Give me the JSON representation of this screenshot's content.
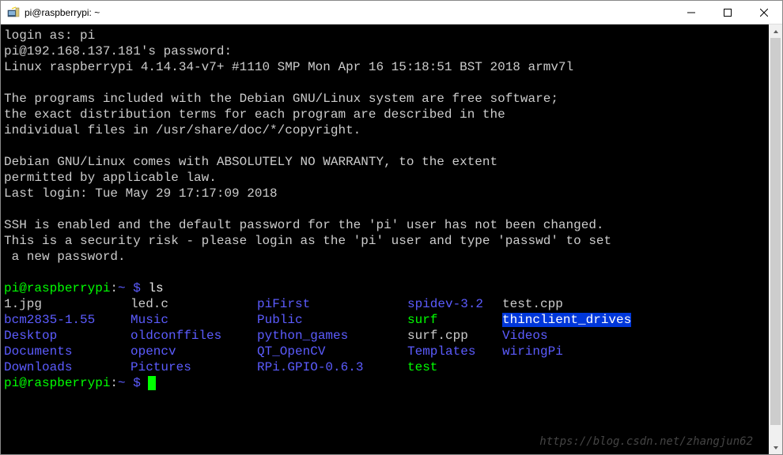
{
  "window": {
    "title": "pi@raspberrypi: ~"
  },
  "terminal": {
    "login_prompt": "login as: ",
    "login_user": "pi",
    "password_prompt": "pi@192.168.137.181's password:",
    "kernel_line": "Linux raspberrypi 4.14.34-v7+ #1110 SMP Mon Apr 16 15:18:51 BST 2018 armv7l",
    "motd1": "The programs included with the Debian GNU/Linux system are free software;",
    "motd2": "the exact distribution terms for each program are described in the",
    "motd3": "individual files in /usr/share/doc/*/copyright.",
    "motd4": "Debian GNU/Linux comes with ABSOLUTELY NO WARRANTY, to the extent",
    "motd5": "permitted by applicable law.",
    "last_login": "Last login: Tue May 29 17:17:09 2018",
    "ssh1": "SSH is enabled and the default password for the 'pi' user has not been changed.",
    "ssh2": "This is a security risk - please login as the 'pi' user and type 'passwd' to set",
    "ssh3": " a new password.",
    "prompt_user": "pi@raspberrypi",
    "prompt_sep": ":",
    "prompt_path": "~ $",
    "cmd1": " ls",
    "ls": {
      "rows": [
        [
          {
            "name": "1.jpg",
            "type": "file"
          },
          {
            "name": "led.c",
            "type": "file"
          },
          {
            "name": "piFirst",
            "type": "dir"
          },
          {
            "name": "spidev-3.2",
            "type": "dir"
          },
          {
            "name": "test.cpp",
            "type": "file"
          }
        ],
        [
          {
            "name": "bcm2835-1.55",
            "type": "dir"
          },
          {
            "name": "Music",
            "type": "dir"
          },
          {
            "name": "Public",
            "type": "dir"
          },
          {
            "name": "surf",
            "type": "exec"
          },
          {
            "name": "thinclient_drives",
            "type": "dir-sel"
          }
        ],
        [
          {
            "name": "Desktop",
            "type": "dir"
          },
          {
            "name": "oldconffiles",
            "type": "dir"
          },
          {
            "name": "python_games",
            "type": "dir"
          },
          {
            "name": "surf.cpp",
            "type": "file"
          },
          {
            "name": "Videos",
            "type": "dir"
          }
        ],
        [
          {
            "name": "Documents",
            "type": "dir"
          },
          {
            "name": "opencv",
            "type": "dir"
          },
          {
            "name": "QT_OpenCV",
            "type": "dir"
          },
          {
            "name": "Templates",
            "type": "dir"
          },
          {
            "name": "wiringPi",
            "type": "dir"
          }
        ],
        [
          {
            "name": "Downloads",
            "type": "dir"
          },
          {
            "name": "Pictures",
            "type": "dir"
          },
          {
            "name": "RPi.GPIO-0.6.3",
            "type": "dir"
          },
          {
            "name": "test",
            "type": "exec"
          },
          {
            "name": "",
            "type": "file"
          }
        ]
      ]
    }
  },
  "watermark": "https://blog.csdn.net/zhangjun62"
}
